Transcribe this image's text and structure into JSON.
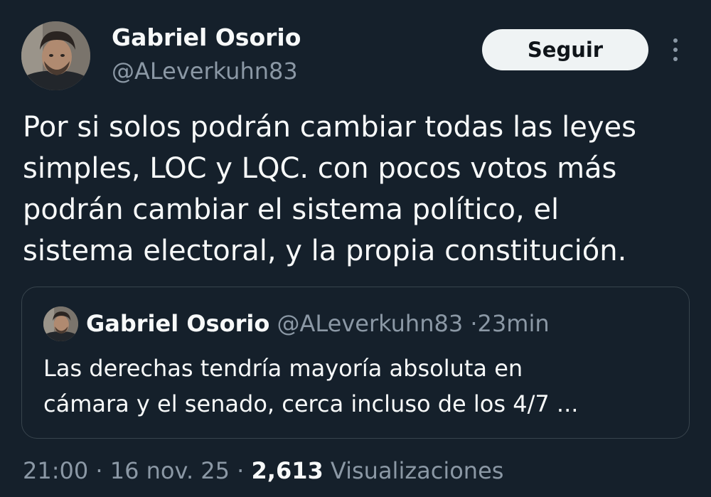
{
  "author": {
    "name": "Gabriel Osorio",
    "handle": "@ALeverkuhn83"
  },
  "follow_label": "Seguir",
  "tweet_text": [
    "Por si solos podrán cambiar todas las leyes",
    "simples, LOC y LQC. con pocos votos más",
    "podrán cambiar el sistema político, el",
    "sistema electoral, y la propia constitución."
  ],
  "quote": {
    "name": "Gabriel Osorio",
    "handle": "@ALeverkuhn83",
    "separator": "·",
    "time": "23min",
    "text": [
      "Las derechas tendría mayoría absoluta en",
      "cámara y el senado, cerca incluso de los 4/7 ..."
    ]
  },
  "meta": {
    "time": "21:00",
    "separator": "·",
    "date": "16 nov. 25",
    "views_count": "2,613",
    "views_label": "Visualizaciones"
  },
  "colors": {
    "background": "#15202b",
    "text": "#f7f9f9",
    "secondary": "#8b98a5",
    "border": "#38444d",
    "button_bg": "#eff3f4"
  }
}
